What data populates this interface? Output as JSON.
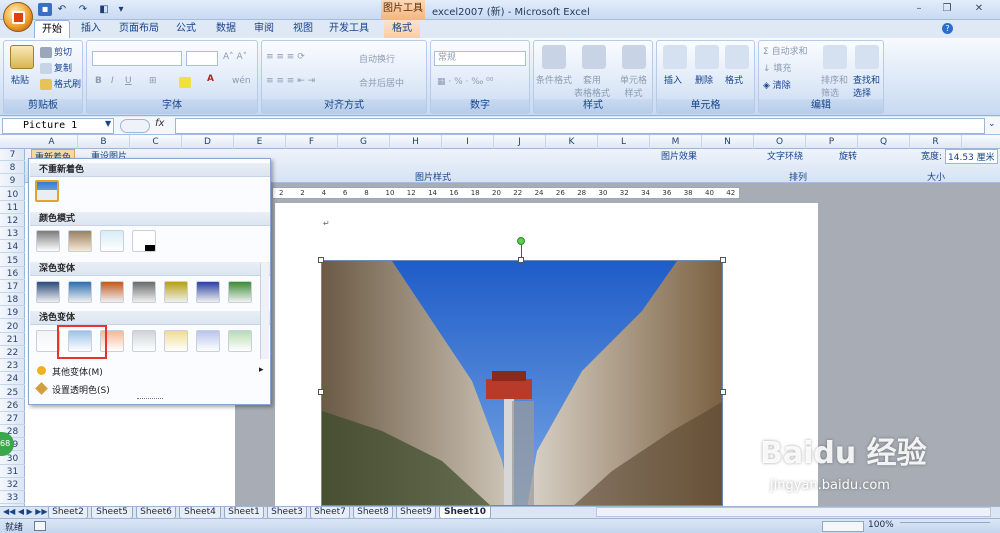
{
  "window": {
    "title": "excel2007 (新) - Microsoft Excel",
    "context_tool": "图片工具"
  },
  "tabs": [
    "开始",
    "插入",
    "页面布局",
    "公式",
    "数据",
    "审阅",
    "视图",
    "开发工具",
    "格式"
  ],
  "ribbon": {
    "clipboard": {
      "label": "剪贴板",
      "paste": "粘贴",
      "cut": "剪切",
      "copy": "复制",
      "format_painter": "格式刷"
    },
    "font": {
      "label": "字体"
    },
    "alignment": {
      "label": "对齐方式",
      "wrap": "自动换行",
      "merge": "合并后居中"
    },
    "number": {
      "label": "数字",
      "format": "常规"
    },
    "styles": {
      "label": "样式",
      "conditional": "条件格式",
      "table": "套用\n表格格式",
      "cell": "单元格\n样式"
    },
    "cells": {
      "label": "单元格",
      "insert": "插入",
      "delete": "删除",
      "format": "格式"
    },
    "editing": {
      "label": "编辑",
      "autosum": "自动求和",
      "fill": "填充",
      "clear": "清除",
      "sort": "排序和\n筛选",
      "find": "查找和\n选择"
    }
  },
  "formula_bar": {
    "name_box": "Picture 1",
    "fx": "fx",
    "value": ""
  },
  "columns": [
    "A",
    "B",
    "C",
    "D",
    "E",
    "F",
    "G",
    "H",
    "I",
    "J",
    "K",
    "L",
    "M",
    "N",
    "O",
    "P",
    "Q",
    "R"
  ],
  "rows": [
    "7",
    "8",
    "9",
    "10",
    "11",
    "12",
    "13",
    "14",
    "15",
    "16",
    "17",
    "18",
    "19",
    "20",
    "21",
    "22",
    "23",
    "24",
    "25",
    "26",
    "27",
    "28",
    "29",
    "30",
    "31",
    "32",
    "33"
  ],
  "picture_ribbon": {
    "recolor": "重新着色",
    "reset": "重设图片",
    "picture_styles": "图片样式",
    "picture_effects": "图片效果",
    "text_wrap": "文字环绕",
    "rotate": "旋转",
    "arrange": "排列",
    "size": "大小",
    "width_label": "宽度:",
    "width_value": "14.53 厘米"
  },
  "ruler_ticks": [
    "2",
    "2",
    "4",
    "6",
    "8",
    "10",
    "12",
    "14",
    "16",
    "18",
    "20",
    "22",
    "24",
    "26",
    "28",
    "30",
    "32",
    "34",
    "36",
    "38",
    "40",
    "42"
  ],
  "recolor_menu": {
    "no_recolor": "不重新着色",
    "color_modes": "颜色模式",
    "dark_variations": "深色变体",
    "light_variations": "浅色变体",
    "more_variations": "其他变体(M)",
    "set_transparent": "设置透明色(S)",
    "dark_colors": [
      "#2a4a7a",
      "#2b6fb0",
      "#c05a20",
      "#6a6a6a",
      "#b8a010",
      "#2a40a0",
      "#3a8a3a"
    ],
    "light_colors": [
      "#f1f3f6",
      "#9cc2e8",
      "#f4b892",
      "#cfd3d8",
      "#f0dc90",
      "#b8c4ec",
      "#b8dcb0"
    ]
  },
  "sheet_tabs": [
    "Sheet2",
    "Sheet5",
    "Sheet6",
    "Sheet4",
    "Sheet1",
    "Sheet3",
    "Sheet7",
    "Sheet8",
    "Sheet9",
    "Sheet10"
  ],
  "active_sheet": "Sheet10",
  "status": {
    "ready": "就绪",
    "zoom": "100%"
  },
  "watermark": {
    "brand": "Baidu 经验",
    "url": "jingyan.baidu.com"
  },
  "badge": "68"
}
